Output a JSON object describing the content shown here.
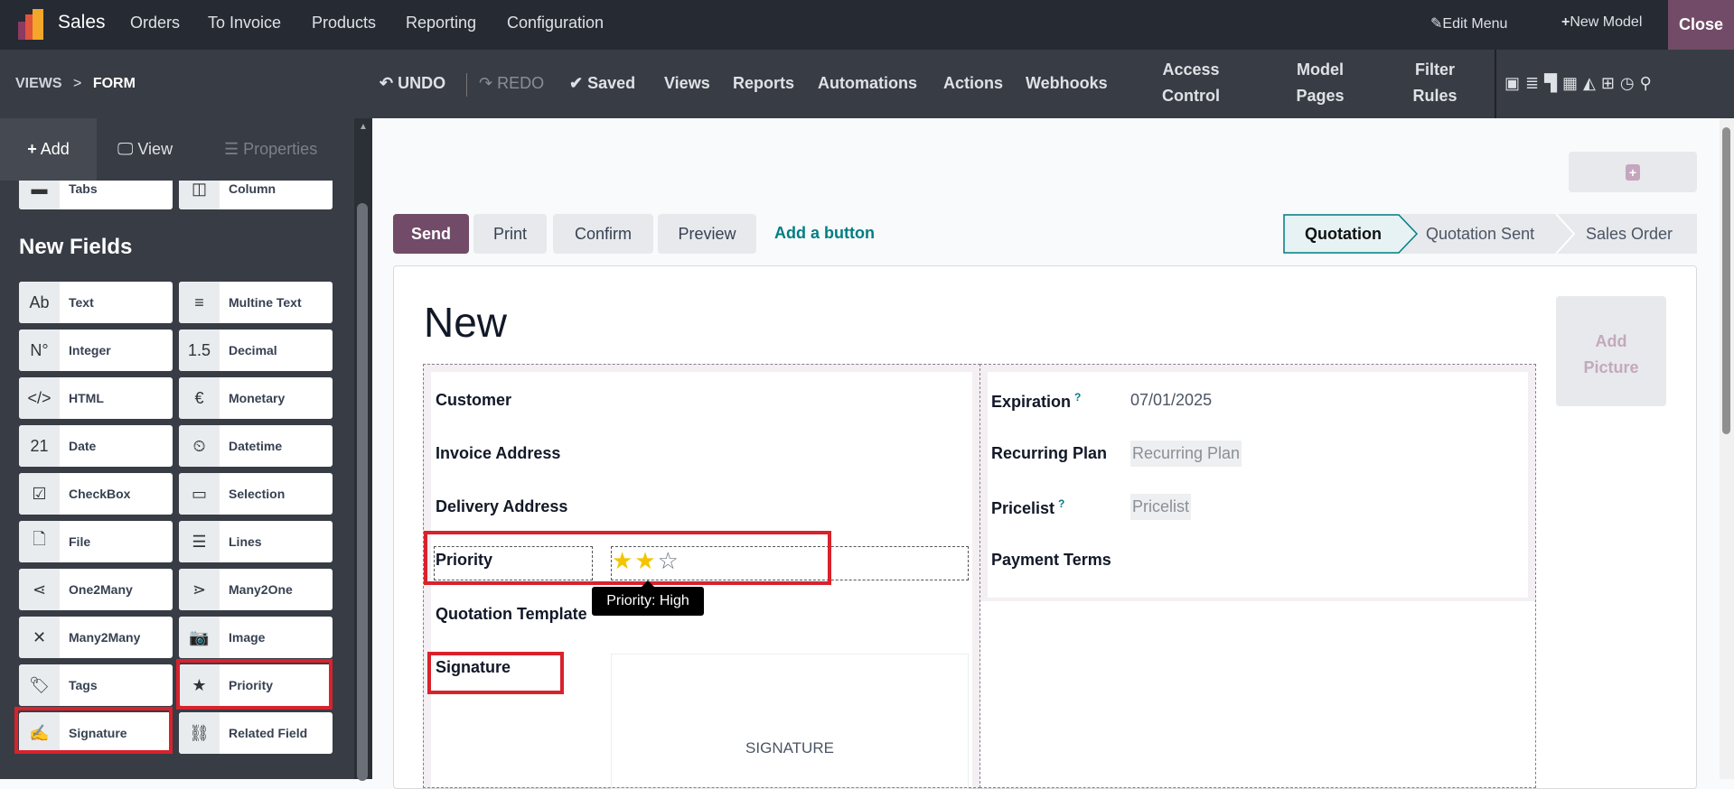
{
  "topbar": {
    "app": "Sales",
    "menu": [
      "Orders",
      "To Invoice",
      "Products",
      "Reporting",
      "Configuration"
    ],
    "edit_menu": "Edit Menu",
    "new_model": "New Model",
    "close": "Close"
  },
  "subbar": {
    "breadcrumb_root": "VIEWS",
    "breadcrumb_sep": ">",
    "breadcrumb_current": "FORM",
    "undo": "UNDO",
    "redo": "REDO",
    "saved": "Saved",
    "views": "Views",
    "reports": "Reports",
    "automations": "Automations",
    "actions": "Actions",
    "webhooks": "Webhooks",
    "access_control": [
      "Access",
      "Control"
    ],
    "model_pages": [
      "Model",
      "Pages"
    ],
    "filter_rules": [
      "Filter",
      "Rules"
    ]
  },
  "panel": {
    "tabs": {
      "add": "Add",
      "view": "View",
      "properties": "Properties"
    },
    "top_items": [
      {
        "label": "Tabs",
        "icon": "tabs-icon"
      },
      {
        "label": "Column",
        "icon": "column-icon"
      }
    ],
    "heading": "New Fields",
    "fields": [
      {
        "label": "Text",
        "glyph": "Ab"
      },
      {
        "label": "Multine Text",
        "glyph": "≡"
      },
      {
        "label": "Integer",
        "glyph": "N°"
      },
      {
        "label": "Decimal",
        "glyph": "1.5"
      },
      {
        "label": "HTML",
        "glyph": "</>"
      },
      {
        "label": "Monetary",
        "glyph": "€"
      },
      {
        "label": "Date",
        "glyph": "21"
      },
      {
        "label": "Datetime",
        "glyph": "⏲"
      },
      {
        "label": "CheckBox",
        "glyph": "☑"
      },
      {
        "label": "Selection",
        "glyph": "▭"
      },
      {
        "label": "File",
        "glyph": "🗋"
      },
      {
        "label": "Lines",
        "glyph": "☰"
      },
      {
        "label": "One2Many",
        "glyph": "⋖"
      },
      {
        "label": "Many2One",
        "glyph": "⋗"
      },
      {
        "label": "Many2Many",
        "glyph": "✕"
      },
      {
        "label": "Image",
        "glyph": "📷"
      },
      {
        "label": "Tags",
        "glyph": "🏷"
      },
      {
        "label": "Priority",
        "glyph": "★"
      },
      {
        "label": "Signature",
        "glyph": "✍"
      },
      {
        "label": "Related Field",
        "glyph": "⛓"
      }
    ]
  },
  "form": {
    "buttons": [
      "Send",
      "Print",
      "Confirm",
      "Preview"
    ],
    "add_button": "Add a button",
    "stages": [
      "Quotation",
      "Quotation Sent",
      "Sales Order"
    ],
    "title": "New",
    "add_picture": [
      "Add",
      "Picture"
    ],
    "left_fields": [
      "Customer",
      "Invoice Address",
      "Delivery Address",
      "Priority",
      "Quotation Template",
      "Signature"
    ],
    "priority_tooltip": "Priority: High",
    "priority_value": 2,
    "priority_max": 3,
    "signature_placeholder": "SIGNATURE",
    "right_fields": {
      "expiration": "Expiration",
      "expiration_value": "07/01/2025",
      "recurring_plan": "Recurring Plan",
      "recurring_plan_placeholder": "Recurring Plan",
      "pricelist": "Pricelist",
      "pricelist_placeholder": "Pricelist",
      "payment_terms": "Payment Terms"
    },
    "help_mark": "?"
  },
  "colors": {
    "brand": "#714b67",
    "highlight": "#d8222c",
    "teal": "#017e84",
    "star": "#f3c400"
  }
}
